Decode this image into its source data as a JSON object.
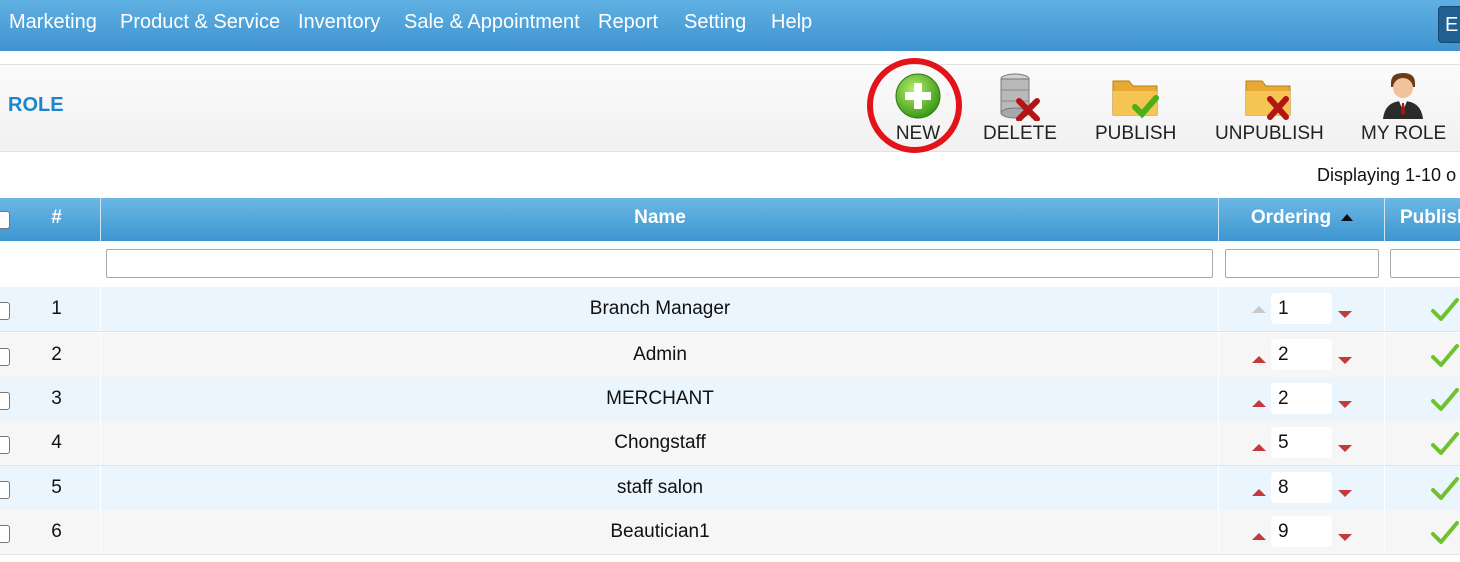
{
  "nav": {
    "items": [
      "Marketing",
      "Product & Service",
      "Inventory",
      "Sale & Appointment",
      "Report",
      "Setting",
      "Help"
    ],
    "lang_label": "E"
  },
  "toolbar": {
    "title": "ROLE",
    "buttons": [
      {
        "label": "NEW",
        "icon": "add-icon"
      },
      {
        "label": "DELETE",
        "icon": "delete-icon"
      },
      {
        "label": "PUBLISH",
        "icon": "publish-folder-icon"
      },
      {
        "label": "UNPUBLISH",
        "icon": "unpublish-folder-icon"
      },
      {
        "label": "MY ROLE",
        "icon": "user-icon"
      }
    ]
  },
  "pagination": {
    "displaying": "Displaying 1-10 o"
  },
  "table": {
    "columns": {
      "num": "#",
      "name": "Name",
      "ordering": "Ordering",
      "published": "Publish"
    },
    "rows": [
      {
        "num": "1",
        "name": "Branch Manager",
        "order": "1",
        "up_disabled": true
      },
      {
        "num": "2",
        "name": "Admin",
        "order": "2",
        "up_disabled": false
      },
      {
        "num": "3",
        "name": "MERCHANT",
        "order": "2",
        "up_disabled": false
      },
      {
        "num": "4",
        "name": "Chongstaff",
        "order": "5",
        "up_disabled": false
      },
      {
        "num": "5",
        "name": "staff salon",
        "order": "8",
        "up_disabled": false
      },
      {
        "num": "6",
        "name": "Beautician1",
        "order": "9",
        "up_disabled": false
      }
    ]
  },
  "colors": {
    "nav": "#3f93cf",
    "title": "#1b86cc",
    "highlight": "#e2141a",
    "arrow": "#c23a3a",
    "check": "#6fc22e"
  }
}
